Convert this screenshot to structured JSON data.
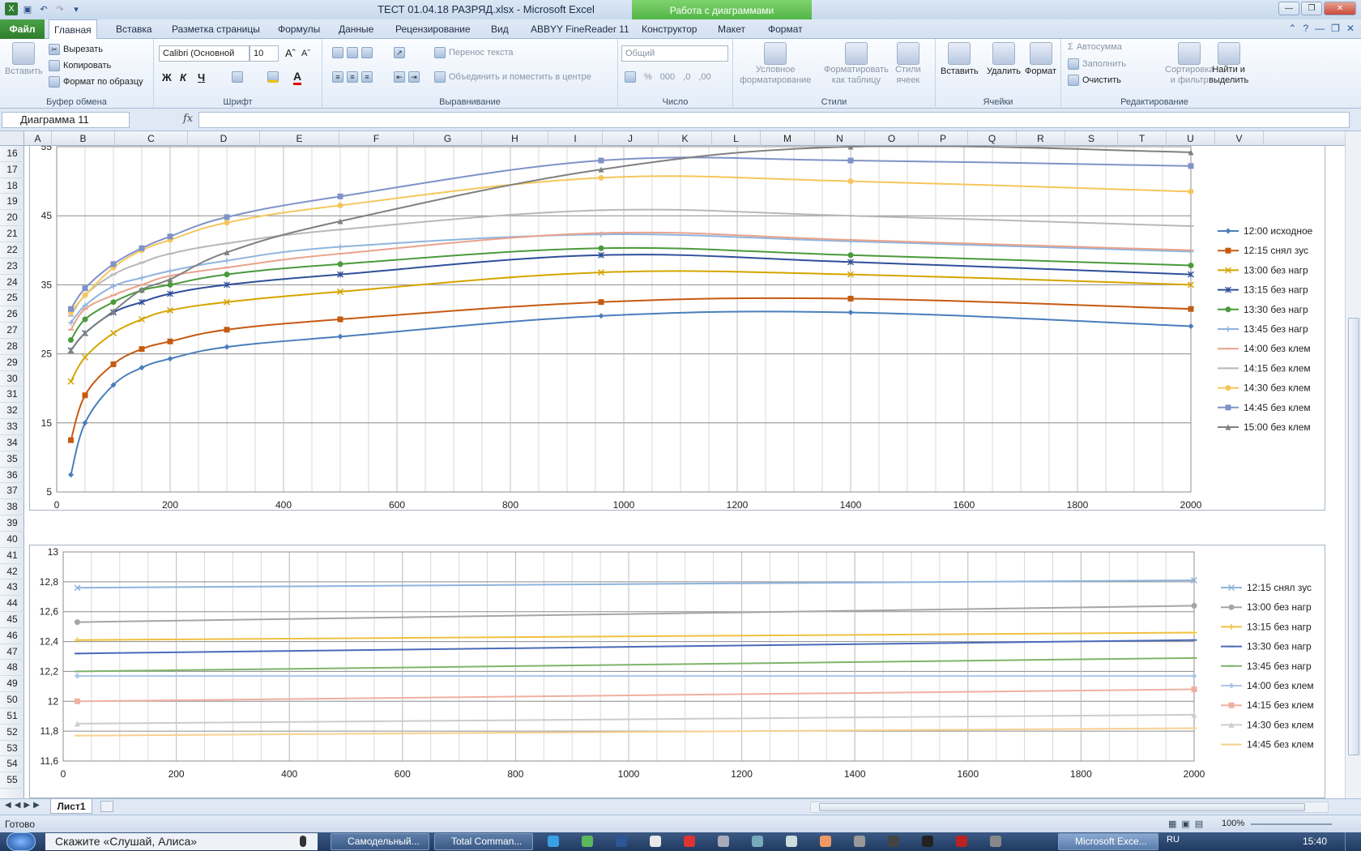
{
  "window": {
    "title": "ТЕСТ 01.04.18 РАЗРЯД.xlsx  -  Microsoft Excel",
    "context_group": "Работа с диаграммами"
  },
  "tabs": [
    {
      "label": "Файл"
    },
    {
      "label": "Главная"
    },
    {
      "label": "Вставка"
    },
    {
      "label": "Разметка страницы"
    },
    {
      "label": "Формулы"
    },
    {
      "label": "Данные"
    },
    {
      "label": "Рецензирование"
    },
    {
      "label": "Вид"
    },
    {
      "label": "ABBYY FineReader 11"
    },
    {
      "label": "Конструктор"
    },
    {
      "label": "Макет"
    },
    {
      "label": "Формат"
    }
  ],
  "ribbon": {
    "clipboard": {
      "paste": "Вставить",
      "cut": "Вырезать",
      "copy": "Копировать",
      "format_painter": "Формат по образцу",
      "label": "Буфер обмена"
    },
    "font": {
      "name": "Calibri (Основной",
      "size": "10",
      "bold": "Ж",
      "italic": "К",
      "underline": "Ч",
      "label": "Шрифт"
    },
    "alignment": {
      "wrap": "Перенос текста",
      "merge": "Объединить и поместить в центре",
      "label": "Выравнивание"
    },
    "number": {
      "format": "Общий",
      "label": "Число"
    },
    "styles": {
      "conditional_1": "Условное",
      "conditional_2": "форматирование",
      "as_table_1": "Форматировать",
      "as_table_2": "как таблицу",
      "cell_styles_1": "Стили",
      "cell_styles_2": "ячеек",
      "label": "Стили"
    },
    "cells": {
      "insert": "Вставить",
      "delete": "Удалить",
      "format": "Формат",
      "label": "Ячейки"
    },
    "editing": {
      "autosum": "Автосумма",
      "fill": "Заполнить",
      "clear": "Очистить",
      "sort_1": "Сортировка",
      "sort_2": "и фильтр",
      "find_1": "Найти и",
      "find_2": "выделить",
      "label": "Редактирование"
    }
  },
  "formula_bar": {
    "name_box": "Диаграмма 11",
    "fx": "fx",
    "value": ""
  },
  "columns": [
    "A",
    "B",
    "C",
    "D",
    "E",
    "F",
    "G",
    "H",
    "I",
    "J",
    "K",
    "L",
    "M",
    "N",
    "O",
    "P",
    "Q",
    "R",
    "S",
    "T",
    "U",
    "V"
  ],
  "rows": [
    "16",
    "17",
    "18",
    "19",
    "20",
    "21",
    "22",
    "23",
    "24",
    "25",
    "26",
    "27",
    "28",
    "29",
    "30",
    "31",
    "32",
    "33",
    "34",
    "35",
    "36",
    "37",
    "38",
    "39",
    "40",
    "41",
    "42",
    "43",
    "44",
    "45",
    "46",
    "47",
    "48",
    "49",
    "50",
    "51",
    "52",
    "53",
    "54",
    "55"
  ],
  "chart_data": [
    {
      "type": "line",
      "x": [
        25,
        50,
        100,
        150,
        200,
        300,
        500,
        960,
        1400,
        2000
      ],
      "xlim": [
        0,
        2000
      ],
      "xticks": [
        "0",
        "200",
        "400",
        "600",
        "800",
        "1000",
        "1200",
        "1400",
        "1600",
        "1800",
        "2000"
      ],
      "ylim": [
        5,
        55
      ],
      "yticks": [
        "5",
        "15",
        "25",
        "35",
        "45",
        "55"
      ],
      "grid": true,
      "legend": "right",
      "series": [
        {
          "name": "12:00 исходное",
          "color": "#4a7ebb",
          "marker": "diamond",
          "values": [
            7.5,
            15,
            20.5,
            23,
            24.3,
            26,
            27.5,
            30.5,
            31,
            29
          ]
        },
        {
          "name": "12:15 снял зус",
          "color": "#c55a11",
          "marker": "square",
          "values": [
            12.5,
            19,
            23.5,
            25.7,
            26.8,
            28.5,
            30,
            32.5,
            33,
            31.5
          ]
        },
        {
          "name": "13:00 без нагр",
          "color": "#d4a500",
          "marker": "x",
          "values": [
            21,
            24.5,
            28,
            30,
            31.3,
            32.5,
            34,
            36.8,
            36.5,
            35
          ]
        },
        {
          "name": "13:15 без нагр",
          "color": "#2f4f9a",
          "marker": "star",
          "values": [
            25.5,
            28,
            31,
            32.5,
            33.7,
            35,
            36.5,
            39.3,
            38.3,
            36.5
          ]
        },
        {
          "name": "13:30 без нагр",
          "color": "#4a9a3c",
          "marker": "circle",
          "values": [
            27,
            30,
            32.5,
            34.2,
            35,
            36.5,
            38,
            40.3,
            39.3,
            37.8
          ]
        },
        {
          "name": "13:45 без нагр",
          "color": "#8fb4de",
          "marker": "plus",
          "values": [
            29.5,
            32,
            34.8,
            36,
            37,
            38.5,
            40.5,
            42.3,
            41.3,
            39.8
          ]
        },
        {
          "name": "14:00 без клем",
          "color": "#e9a38c",
          "marker": "dash",
          "values": [
            28.5,
            31.5,
            33.5,
            35,
            36.3,
            37.5,
            39.5,
            42.5,
            41.5,
            40
          ]
        },
        {
          "name": "14:15 без клем",
          "color": "#b8b8b8",
          "marker": "dash",
          "values": [
            30.5,
            33.5,
            36.5,
            38.2,
            39.5,
            41,
            43,
            45.8,
            45,
            43.5
          ]
        },
        {
          "name": "14:30 без клем",
          "color": "#f5c65c",
          "marker": "circle",
          "values": [
            31,
            33.5,
            37.5,
            40,
            41.5,
            44,
            46.5,
            50.5,
            50,
            48.5
          ]
        },
        {
          "name": "14:45 без клем",
          "color": "#7f93c6",
          "marker": "square",
          "values": [
            31.5,
            34.5,
            38,
            40.3,
            42,
            44.8,
            47.8,
            53,
            53,
            52.2
          ]
        },
        {
          "name": "15:00 без клем",
          "color": "#808080",
          "marker": "triangle",
          "values": [
            25.5,
            28,
            31.2,
            34.3,
            35.8,
            39.7,
            44.2,
            51.7,
            55,
            54.2
          ]
        }
      ]
    },
    {
      "type": "line",
      "x": [
        25,
        2000
      ],
      "xlim": [
        0,
        2000
      ],
      "xticks": [
        "0",
        "200",
        "400",
        "600",
        "800",
        "1000",
        "1200",
        "1400",
        "1600",
        "1800",
        "2000"
      ],
      "ylim": [
        11.6,
        13
      ],
      "yticks": [
        "11,6",
        "11,8",
        "12",
        "12,2",
        "12,4",
        "12,6",
        "12,8",
        "13"
      ],
      "grid": true,
      "legend": "right",
      "series": [
        {
          "name": "12:15 снял зус",
          "color": "#8fb4de",
          "marker": "x",
          "values": [
            12.76,
            12.81
          ]
        },
        {
          "name": "13:00 без нагр",
          "color": "#a6a6a6",
          "marker": "circle",
          "values": [
            12.53,
            12.64
          ]
        },
        {
          "name": "13:15 без нагр",
          "color": "#f0c040",
          "marker": "plus",
          "values": [
            12.41,
            12.46
          ]
        },
        {
          "name": "13:30 без нагр",
          "color": "#4b6bb8",
          "marker": "dash",
          "values": [
            12.32,
            12.41
          ]
        },
        {
          "name": "13:45 без нагр",
          "color": "#7fb46a",
          "marker": "dash",
          "values": [
            12.2,
            12.29
          ]
        },
        {
          "name": "14:00 без клем",
          "color": "#aec7e8",
          "marker": "diamond",
          "values": [
            12.17,
            12.17
          ]
        },
        {
          "name": "14:15 без клем",
          "color": "#f0b0a0",
          "marker": "square",
          "values": [
            12,
            12.08
          ]
        },
        {
          "name": "14:30 без клем",
          "color": "#cccccc",
          "marker": "triangle",
          "values": [
            11.85,
            11.91
          ]
        },
        {
          "name": "14:45 без клем",
          "color": "#f8d090",
          "marker": "dash",
          "values": [
            11.77,
            11.82
          ]
        }
      ]
    }
  ],
  "sheet_tab": "Лист1",
  "status": {
    "ready": "Готово",
    "zoom": "100%"
  },
  "taskbar": {
    "search": "Скажите «Слушай, Алиса»",
    "tasks": [
      "Самодельный...",
      "Total Comman...",
      "Microsoft Exce..."
    ],
    "lang": "RU",
    "clock": "15:40"
  }
}
